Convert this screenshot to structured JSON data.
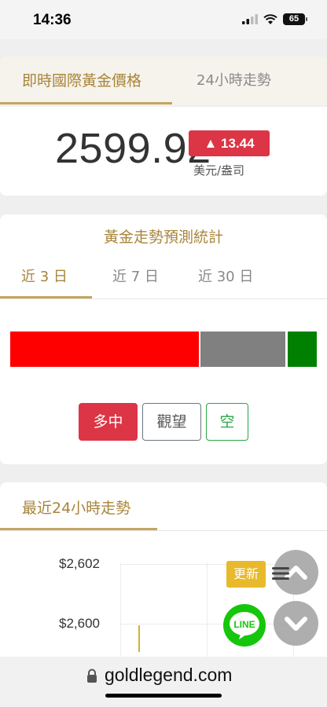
{
  "status_bar": {
    "time": "14:36",
    "battery": "65"
  },
  "price_tabs": {
    "live": "即時國際黃金價格",
    "trend_24h": "24小時走勢"
  },
  "price": {
    "value": "2599.92",
    "change": "▲ 13.44",
    "unit": "美元/盎司"
  },
  "forecast": {
    "title": "黃金走勢預測統計",
    "tabs": [
      "近 3 日",
      "近 7 日",
      "近 30 日"
    ],
    "active_tab": "近 3 日",
    "distribution": {
      "long": 0.61,
      "neutral": 0.28,
      "short": 0.11
    },
    "buttons": {
      "long": "多中",
      "watch": "觀望",
      "short": "空"
    },
    "colors": {
      "long": "#ff0000",
      "neutral": "#808080",
      "short": "#008000"
    }
  },
  "trend": {
    "title": "最近24小時走勢",
    "y_ticks": [
      "$2,602",
      "$2,600"
    ]
  },
  "floating": {
    "refresh": "更新",
    "line": "LINE"
  },
  "url_bar": {
    "url": "goldlegend.com"
  }
}
